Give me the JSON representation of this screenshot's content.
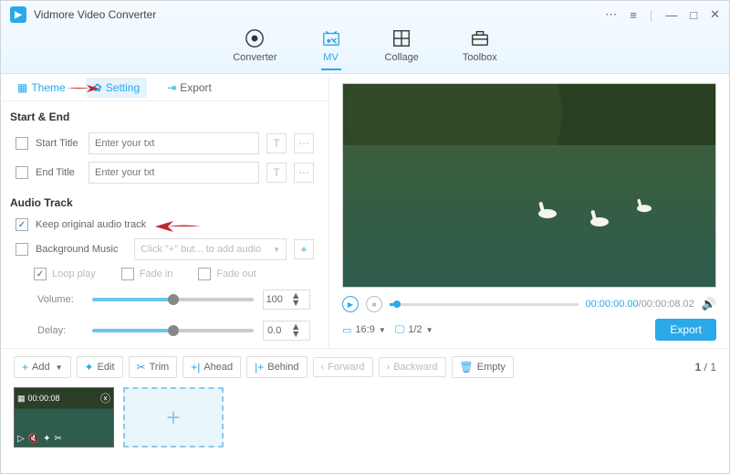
{
  "app": {
    "title": "Vidmore Video Converter"
  },
  "main_tabs": {
    "converter": "Converter",
    "mv": "MV",
    "collage": "Collage",
    "toolbox": "Toolbox"
  },
  "sub_tabs": {
    "theme": "Theme",
    "setting": "Setting",
    "export": "Export"
  },
  "start_end": {
    "title": "Start & End",
    "start_label": "Start Title",
    "end_label": "End Title",
    "placeholder": "Enter your txt"
  },
  "audio": {
    "title": "Audio Track",
    "keep_original": "Keep original audio track",
    "bg_music": "Background Music",
    "bg_placeholder": "Click \"+\" but... to add audio",
    "loop": "Loop play",
    "fade_in": "Fade in",
    "fade_out": "Fade out",
    "volume_label": "Volume:",
    "volume_value": "100",
    "delay_label": "Delay:",
    "delay_value": "0.0"
  },
  "preview_controls": {
    "time_current": "00:00:00.00",
    "time_total": "00:00:08.02",
    "ratio": "16:9",
    "zoom": "1/2",
    "export": "Export"
  },
  "actions": {
    "add": "Add",
    "edit": "Edit",
    "trim": "Trim",
    "ahead": "Ahead",
    "behind": "Behind",
    "forward": "Forward",
    "backward": "Backward",
    "empty": "Empty"
  },
  "pagination": {
    "current": "1",
    "total": "1"
  },
  "thumbnail": {
    "duration": "00:00:08"
  }
}
